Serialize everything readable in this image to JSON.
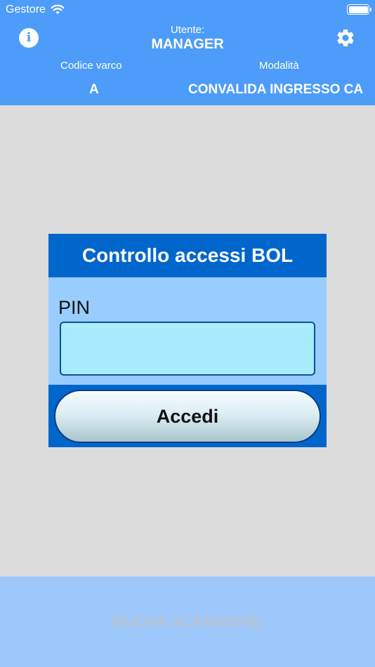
{
  "status_bar": {
    "carrier": "Gestore",
    "icons": [
      "wifi-icon",
      "battery-icon"
    ]
  },
  "header": {
    "user_label": "Utente:",
    "user_name": "MANAGER",
    "gate_label": "Codice varco",
    "gate_value": "A",
    "mode_label": "Modalità",
    "mode_value": "CONVALIDA INGRESSO CA",
    "info_icon": "info-icon",
    "settings_icon": "gear-icon",
    "background_color": "#4d9cf9"
  },
  "dialog": {
    "title": "Controllo accessi BOL",
    "pin_label": "PIN",
    "pin_value": "",
    "login_label": "Accedi",
    "title_color": "#0066cc",
    "body_color": "#99ccff",
    "input_color": "#a8ecfd"
  },
  "footer": {
    "new_scan_label": "NUOVA SCANSIONE",
    "background_color": "#9cc7fb"
  }
}
